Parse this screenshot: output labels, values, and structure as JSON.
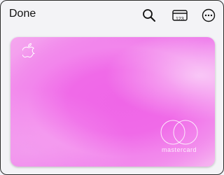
{
  "header": {
    "done_label": "Done",
    "card_number_label": "123"
  },
  "card": {
    "network_label": "mastercard",
    "gradient_colors": [
      "#f5a8ef",
      "#ee66e7",
      "#f6b3f0"
    ]
  },
  "icons": {
    "search": "search-icon",
    "card_number": "card-number-icon",
    "more": "more-icon",
    "apple": "apple-logo",
    "network": "mastercard-logo"
  }
}
